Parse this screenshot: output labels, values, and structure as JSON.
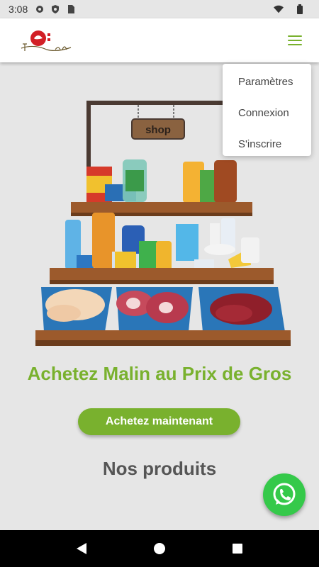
{
  "status_bar": {
    "time": "3:08",
    "icons": [
      "settings-icon",
      "shield-icon",
      "sim-card-icon",
      "wifi-icon",
      "battery-icon"
    ]
  },
  "header": {
    "logo_text": "Touta Ecoleal",
    "menu_icon": "hamburger-menu-icon",
    "accent_color": "#79b12e"
  },
  "dropdown": {
    "items": [
      {
        "label": "Paramètres"
      },
      {
        "label": "Connexion"
      },
      {
        "label": "S'inscrire"
      }
    ]
  },
  "hero": {
    "sign_text": "shop"
  },
  "main": {
    "tagline": "Achetez Malin au Prix de Gros",
    "cta_label": "Achetez maintenant",
    "section_title": "Nos produits"
  },
  "floating": {
    "icon": "whatsapp-icon"
  },
  "nav_bar": {
    "icons": [
      "back-icon",
      "home-icon",
      "recents-icon"
    ]
  }
}
